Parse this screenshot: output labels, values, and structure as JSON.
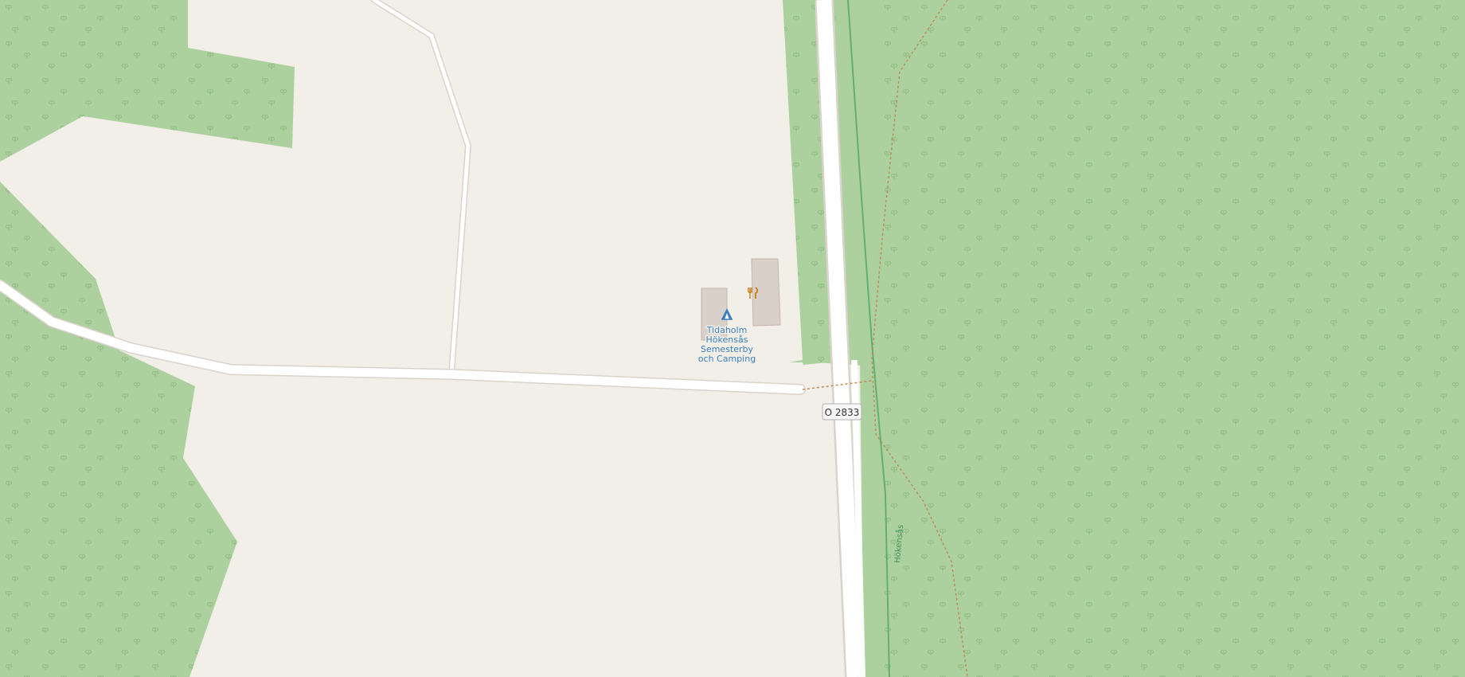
{
  "map": {
    "colors": {
      "land": "#f2efe9",
      "forest": "#add19e",
      "road_fill": "#ffffff",
      "road_casing": "#d9d3cb",
      "building": "#d9d0c9",
      "building_outline": "#c4b6ab",
      "path": "#c08a55",
      "stream": "#62b06e",
      "poi_label": "#3b7fbf",
      "restaurant_icon": "#c77400"
    },
    "poi": {
      "camp_site": {
        "icon": "camping-tent-icon",
        "label_lines": [
          "Tidaholm",
          "Hökensås",
          "Semesterby",
          "och Camping"
        ]
      },
      "restaurant": {
        "icon": "fork-knife-icon"
      }
    },
    "road_shield": {
      "ref": "O 2833"
    },
    "stream": {
      "name": "Hökensås"
    }
  }
}
